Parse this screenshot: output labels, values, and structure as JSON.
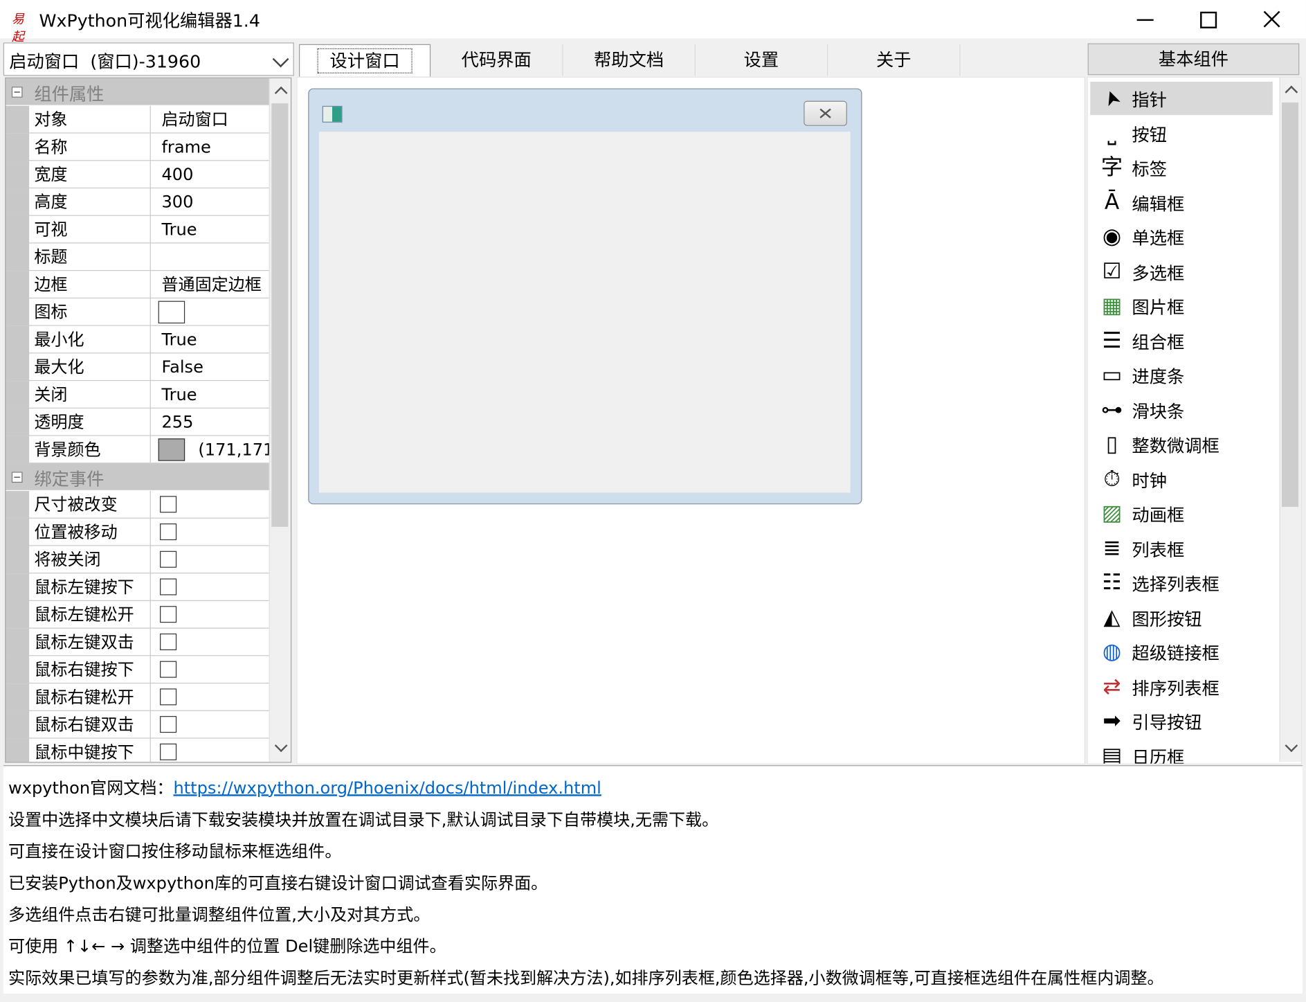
{
  "window": {
    "title": "WxPython可视化编辑器1.4",
    "logo_text": "易起"
  },
  "object_select": {
    "value": "启动窗口  (窗口)-31960"
  },
  "properties": {
    "category_props": "组件属性",
    "rows": [
      {
        "name": "对象",
        "value": "启动窗口"
      },
      {
        "name": "名称",
        "value": "frame"
      },
      {
        "name": "宽度",
        "value": "400"
      },
      {
        "name": "高度",
        "value": "300"
      },
      {
        "name": "可视",
        "value": "True"
      },
      {
        "name": "标题",
        "value": ""
      },
      {
        "name": "边框",
        "value": "普通固定边框"
      },
      {
        "name": "图标",
        "value": ""
      },
      {
        "name": "最小化",
        "value": "True"
      },
      {
        "name": "最大化",
        "value": "False"
      },
      {
        "name": "关闭",
        "value": "True"
      },
      {
        "name": "透明度",
        "value": "255"
      },
      {
        "name": "背景颜色",
        "value": "(171,171,"
      }
    ],
    "background_color": "#ababab",
    "category_events": "绑定事件",
    "events": [
      {
        "name": "尺寸被改变",
        "checked": false
      },
      {
        "name": "位置被移动",
        "checked": false
      },
      {
        "name": "将被关闭",
        "checked": false
      },
      {
        "name": "鼠标左键按下",
        "checked": false
      },
      {
        "name": "鼠标左键松开",
        "checked": false
      },
      {
        "name": "鼠标左键双击",
        "checked": false
      },
      {
        "name": "鼠标右键按下",
        "checked": false
      },
      {
        "name": "鼠标右键松开",
        "checked": false
      },
      {
        "name": "鼠标右键双击",
        "checked": false
      },
      {
        "name": "鼠标中键按下",
        "checked": false
      }
    ]
  },
  "tabs": [
    {
      "label": "设计窗口",
      "active": true
    },
    {
      "label": "代码界面",
      "active": false
    },
    {
      "label": "帮助文档",
      "active": false
    },
    {
      "label": "设置",
      "active": false
    },
    {
      "label": "关于",
      "active": false
    }
  ],
  "components": {
    "header": "基本组件",
    "items": [
      {
        "label": "指针",
        "icon": "pointer-icon",
        "selected": true
      },
      {
        "label": "按钮",
        "icon": "button-icon"
      },
      {
        "label": "标签",
        "icon": "label-icon"
      },
      {
        "label": "编辑框",
        "icon": "textbox-icon"
      },
      {
        "label": "单选框",
        "icon": "radio-icon"
      },
      {
        "label": "多选框",
        "icon": "checkbox-icon"
      },
      {
        "label": "图片框",
        "icon": "picture-icon"
      },
      {
        "label": "组合框",
        "icon": "combobox-icon"
      },
      {
        "label": "进度条",
        "icon": "progressbar-icon"
      },
      {
        "label": "滑块条",
        "icon": "slider-icon"
      },
      {
        "label": "整数微调框",
        "icon": "spinctrl-icon"
      },
      {
        "label": "时钟",
        "icon": "timer-icon"
      },
      {
        "label": "动画框",
        "icon": "animation-icon"
      },
      {
        "label": "列表框",
        "icon": "listbox-icon"
      },
      {
        "label": "选择列表框",
        "icon": "checklistbox-icon"
      },
      {
        "label": "图形按钮",
        "icon": "bitmap-button-icon"
      },
      {
        "label": "超级链接框",
        "icon": "hyperlink-icon"
      },
      {
        "label": "排序列表框",
        "icon": "rearrange-list-icon"
      },
      {
        "label": "引导按钮",
        "icon": "command-link-icon"
      },
      {
        "label": "日历框",
        "icon": "calendar-icon"
      }
    ]
  },
  "info": {
    "doc_label": "wxpython官网文档：",
    "doc_link": "https://wxpython.org/Phoenix/docs/html/index.html",
    "lines": [
      "设置中选择中文模块后请下载安装模块并放置在调试目录下,默认调试目录下自带模块,无需下载。",
      "可直接在设计窗口按住移动鼠标来框选组件。",
      "已安装Python及wxpython库的可直接右键设计窗口调试查看实际界面。",
      "多选组件点击右键可批量调整组件位置,大小及对其方式。",
      "可使用 ↑↓← → 调整选中组件的位置 Del键删除选中组件。",
      "实际效果已填写的参数为准,部分组件调整后无法实时更新样式(暂未找到解决方法),如排序列表框,颜色选择器,小数微调框等,可直接框选组件在属性框内调整。"
    ]
  }
}
